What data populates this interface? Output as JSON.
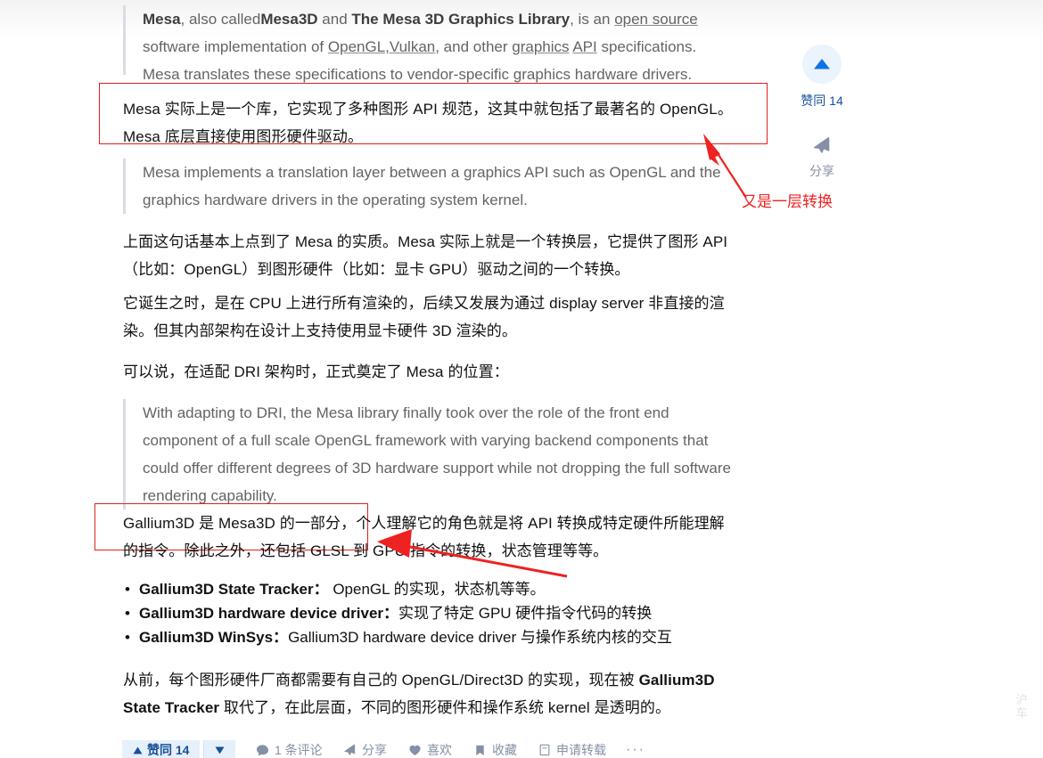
{
  "theme": {
    "accent_blue": "#175199",
    "muted_blue": "#8590a6",
    "annotation_red": "#ee2222",
    "quote_gray": "#646464",
    "quote_bar": "#d7dde3",
    "upvote_bg": "#ebf3fc"
  },
  "article": {
    "quote_intro": {
      "p1_a": "Mesa",
      "p1_b": ", also called",
      "p1_c": "Mesa3D",
      "p1_d": " and ",
      "p1_e": "The Mesa 3D Graphics Library",
      "p1_f": ", is an ",
      "p1_g": "open source",
      "p1_h": "software implementation of ",
      "p1_i": "OpenGL,Vulkan",
      "p1_j": ", and other ",
      "p1_k": "graphics",
      "p1_l": " ",
      "p1_m": "API",
      "p1_n": " specifications. Mesa translates these specifications to vendor-specific graphics hardware drivers."
    },
    "highlight_1": "Mesa 实际上是一个库，它实现了多种图形 API 规范，这其中就包括了最著名的 OpenGL。Mesa 底层直接使用图形硬件驱动。",
    "quote_2": "Mesa implements a translation layer between a graphics API such as OpenGL and the graphics hardware drivers in the operating system kernel.",
    "para_1": "上面这句话基本上点到了 Mesa 的实质。Mesa 实际上就是一个转换层，它提供了图形 API（比如：OpenGL）到图形硬件（比如：显卡 GPU）驱动之间的一个转换。",
    "para_2": "它诞生之时，是在 CPU 上进行所有渲染的，后续又发展为通过 display server 非直接的渲染。但其内部架构在设计上支持使用显卡硬件 3D 渲染的。",
    "para_3": "可以说，在适配 DRI 架构时，正式奠定了 Mesa 的位置：",
    "quote_3": "With adapting to DRI, the Mesa library finally took over the role of the front end component of a full scale OpenGL framework with varying backend components that could offer different degrees of 3D hardware support while not dropping the full software rendering capability.",
    "highlight_2": "Gallium3D 是 Mesa3D 的一部分，个人理解它的角色就是将 API 转换成特定硬件所能理解的指令。除此之外，还包括 GLSL 到 GPU 指令的转换，状态管理等等。",
    "bullets": [
      {
        "term": "Gallium3D State Tracker：",
        "desc": " OpenGL 的实现，状态机等等。"
      },
      {
        "term": "Gallium3D hardware device driver：",
        "desc": "实现了特定 GPU 硬件指令代码的转换"
      },
      {
        "term": "Gallium3D WinSys：",
        "desc": "Gallium3D hardware device driver 与操作系统内核的交互"
      }
    ],
    "para_4": {
      "a": "从前，每个图形硬件厂商都需要有自己的 OpenGL/Direct3D 的实现，现在被 ",
      "b": "Gallium3D State Tracker",
      "c": " 取代了，在此层面，不同的图形硬件和操作系统 kernel 是透明的。"
    }
  },
  "annotations": [
    {
      "id": "annot-layer-note",
      "text": "又是一层转换"
    }
  ],
  "action_rail": {
    "upvote_icon": "triangle-up-icon",
    "upvote_label": "赞同 14",
    "share_icon": "paper-plane-icon",
    "share_label": "分享"
  },
  "bottom_bar": {
    "upvote_label": "赞同 14",
    "upvote_icon": "triangle-up-icon",
    "downvote_icon": "triangle-down-icon",
    "comments_label": "1 条评论",
    "comments_icon": "comment-icon",
    "share_label": "分享",
    "share_icon": "paper-plane-icon",
    "like_label": "喜欢",
    "like_icon": "heart-icon",
    "favorite_label": "收藏",
    "favorite_icon": "bookmark-icon",
    "repost_label": "申请转载",
    "repost_icon": "document-icon",
    "more_label": "···"
  },
  "watermark": {
    "line1": "沪",
    "line2": "车"
  }
}
